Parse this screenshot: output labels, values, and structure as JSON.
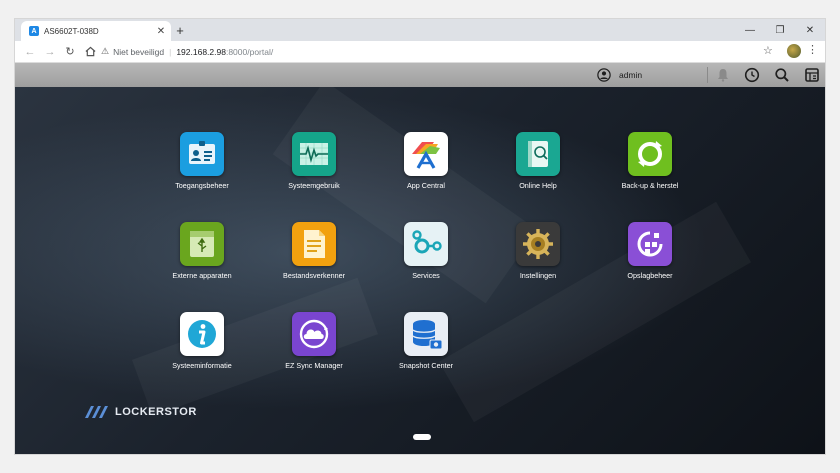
{
  "browser": {
    "tab_title": "AS6602T-038D",
    "tab_favicon": "A",
    "tab_close": "✕",
    "new_tab": "+",
    "window_controls": {
      "minimize": "—",
      "maximize": "❐",
      "close": "✕"
    },
    "security_text": "Niet beveiligd",
    "url_host": "192.168.2.98",
    "url_path": ":8000/portal/"
  },
  "header": {
    "username": "admin"
  },
  "apps": [
    {
      "label": "Toegangsbeheer",
      "icon": "id-card-icon",
      "color": "#1b9ee0"
    },
    {
      "label": "Systeemgebruik",
      "icon": "heartbeat-chart-icon",
      "color": "#15a58a"
    },
    {
      "label": "App Central",
      "icon": "app-central-icon",
      "color": "#ffffff"
    },
    {
      "label": "Online Help",
      "icon": "help-book-icon",
      "color": "#1aa792"
    },
    {
      "label": "Back-up & herstel",
      "icon": "backup-restore-icon",
      "color": "#6fbf1f"
    },
    {
      "label": "Externe apparaten",
      "icon": "usb-drive-icon",
      "color": "#6aa61e"
    },
    {
      "label": "Bestandsverkenner",
      "icon": "file-folder-icon",
      "color": "#f2a10f"
    },
    {
      "label": "Services",
      "icon": "services-icon",
      "color": "#e6f2f5"
    },
    {
      "label": "Instellingen",
      "icon": "gear-icon",
      "color": "#3a3a3a"
    },
    {
      "label": "Opslagbeheer",
      "icon": "storage-manager-icon",
      "color": "#8a4fd6"
    },
    {
      "label": "Systeeminformatie",
      "icon": "info-icon",
      "color": "#ffffff"
    },
    {
      "label": "EZ Sync Manager",
      "icon": "cloud-sync-icon",
      "color": "#7a45d0"
    },
    {
      "label": "Snapshot Center",
      "icon": "snapshot-icon",
      "color": "#e9eef5"
    }
  ],
  "brand": {
    "logo_text": "LOCKERSTOR"
  }
}
